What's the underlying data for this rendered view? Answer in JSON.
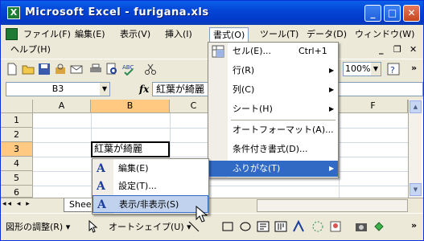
{
  "window": {
    "title": "Microsoft Excel - furigana.xls",
    "min_glyph": "_",
    "max_glyph": "□",
    "close_glyph": "✕",
    "app_glyph": "X"
  },
  "menubar": {
    "items": [
      {
        "label": "ファイル(F)"
      },
      {
        "label": "編集(E)"
      },
      {
        "label": "表示(V)"
      },
      {
        "label": "挿入(I)"
      },
      {
        "label": "書式(O)"
      },
      {
        "label": "ツール(T)"
      },
      {
        "label": "データ(D)"
      },
      {
        "label": "ウィンドウ(W)"
      },
      {
        "label": "ヘルプ(H)"
      }
    ],
    "doc_min": "_",
    "doc_restore": "❐",
    "doc_close": "✕"
  },
  "toolbar": {
    "zoom": "100%",
    "more_glyph": "»"
  },
  "formula_bar": {
    "cell_ref": "B3",
    "fx_label": "fx",
    "content": "紅葉が綺麗"
  },
  "grid": {
    "columns": [
      "A",
      "B",
      "C",
      "F"
    ],
    "rows": [
      "1",
      "2",
      "3",
      "4",
      "5",
      "6"
    ],
    "active_cell_value": "紅葉が綺麗"
  },
  "format_menu": {
    "items": [
      {
        "label": "セル(E)...",
        "shortcut": "Ctrl+1"
      },
      {
        "label": "行(R)"
      },
      {
        "label": "列(C)"
      },
      {
        "label": "シート(H)"
      },
      {
        "label": "オートフォーマット(A)..."
      },
      {
        "label": "条件付き書式(D)..."
      },
      {
        "label": "ふりがな(T)"
      }
    ],
    "expand_glyph": "»"
  },
  "furigana_submenu": {
    "items": [
      {
        "label": "編集(E)",
        "icon": "A"
      },
      {
        "label": "設定(T)...",
        "icon": "A"
      },
      {
        "label": "表示/非表示(S)",
        "icon": "A"
      }
    ]
  },
  "sheet_bar": {
    "nav": "◂◂ ◂ ▸",
    "tab_label": "Sheet"
  },
  "draw_toolbar": {
    "draw_label": "図形の調整(R) ▾",
    "autoshape_label": "オートシェイプ(U) ▾"
  },
  "colors": {
    "title_blue": "#0446D6",
    "menu_highlight": "#316AC5",
    "selected_header": "#FFC982"
  }
}
